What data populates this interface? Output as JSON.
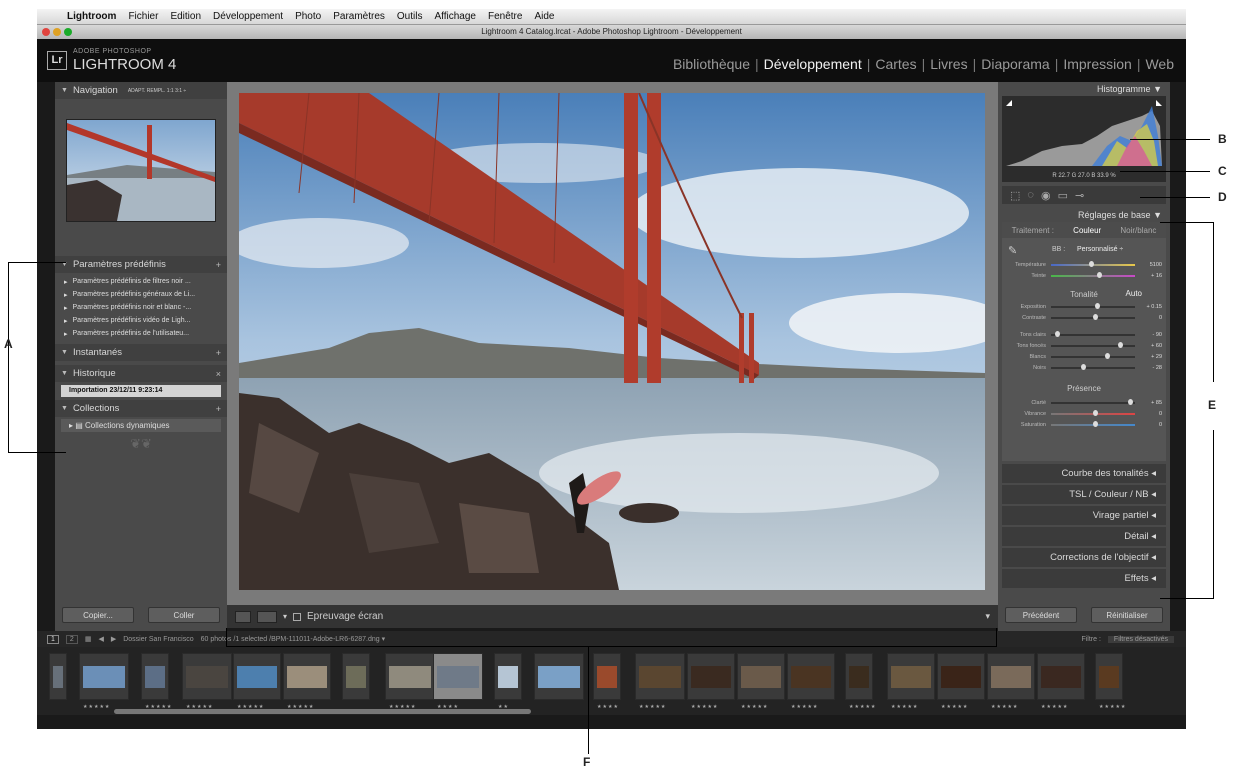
{
  "menubar": {
    "apple_icon": "",
    "app": "Lightroom",
    "items": [
      "Fichier",
      "Edition",
      "Développement",
      "Photo",
      "Paramètres",
      "Outils",
      "Affichage",
      "Fenêtre",
      "Aide"
    ]
  },
  "window_title": "Lightroom 4 Catalog.lrcat - Adobe Photoshop Lightroom - Développement",
  "identity": {
    "badge": "Lr",
    "brand_small": "ADOBE PHOTOSHOP",
    "brand_big": "LIGHTROOM 4",
    "modules": [
      "Bibliothèque",
      "Développement",
      "Cartes",
      "Livres",
      "Diaporama",
      "Impression",
      "Web"
    ],
    "active_module": "Développement"
  },
  "left": {
    "navigation": {
      "title": "Navigation",
      "options": "ADAPT.  REMPL.  1:1  3:1 ÷"
    },
    "presets": {
      "title": "Paramètres prédéfinis",
      "items": [
        "Paramètres prédéfinis de filtres noir ...",
        "Paramètres prédéfinis généraux de Li...",
        "Paramètres prédéfinis noir et blanc -...",
        "Paramètres prédéfinis vidéo de Ligh...",
        "Paramètres prédéfinis de l'utilisateu..."
      ]
    },
    "snapshots": {
      "title": "Instantanés"
    },
    "history": {
      "title": "Historique",
      "item": "Importation  23/12/11 9:23:14"
    },
    "collections": {
      "title": "Collections",
      "item": "Collections dynamiques"
    },
    "copy_label": "Copier...",
    "paste_label": "Coller"
  },
  "toolbar": {
    "softproof": "Epreuvage écran"
  },
  "right": {
    "histogram_title": "Histogramme",
    "hist_values": "R  22.7  G  27.0  B  33.9 %",
    "basic_title": "Réglages de base",
    "tabs": [
      "Traitement :",
      "Couleur",
      "Noir/blanc"
    ],
    "wb_label": "BB :",
    "wb_value": "Personnalisé ÷",
    "tone_label": "Tonalité",
    "auto_label": "Auto",
    "presence_label": "Présence",
    "sliders": [
      {
        "label": "Température",
        "value": "5100"
      },
      {
        "label": "Teinte",
        "value": "+ 16"
      },
      {
        "label": "Exposition",
        "value": "+ 0.15"
      },
      {
        "label": "Contraste",
        "value": "0"
      },
      {
        "label": "Tons clairs",
        "value": "- 90"
      },
      {
        "label": "Tons foncés",
        "value": "+ 60"
      },
      {
        "label": "Blancs",
        "value": "+ 29"
      },
      {
        "label": "Noirs",
        "value": "- 28"
      },
      {
        "label": "Clarté",
        "value": "+ 85"
      },
      {
        "label": "Vibrance",
        "value": "0"
      },
      {
        "label": "Saturation",
        "value": "0"
      }
    ],
    "sections": [
      "Courbe des tonalités",
      "TSL / Couleur / NB",
      "Virage partiel",
      "Détail",
      "Corrections de l'objectif",
      "Effets"
    ],
    "prev_label": "Précédent",
    "reset_label": "Réinitialiser"
  },
  "filmbar": {
    "page1": "1",
    "page2": "2",
    "folder": "Dossier  San Francisco",
    "count": "60 photos /1 selected /BPM-111011-Adobe-LR6-6287.dng ▾",
    "filter_label": "Filtre :",
    "filter_value": "Filtres désactivés"
  },
  "callouts": {
    "a": "A",
    "b": "B",
    "c": "C",
    "d": "D",
    "e": "E",
    "f": "F"
  }
}
